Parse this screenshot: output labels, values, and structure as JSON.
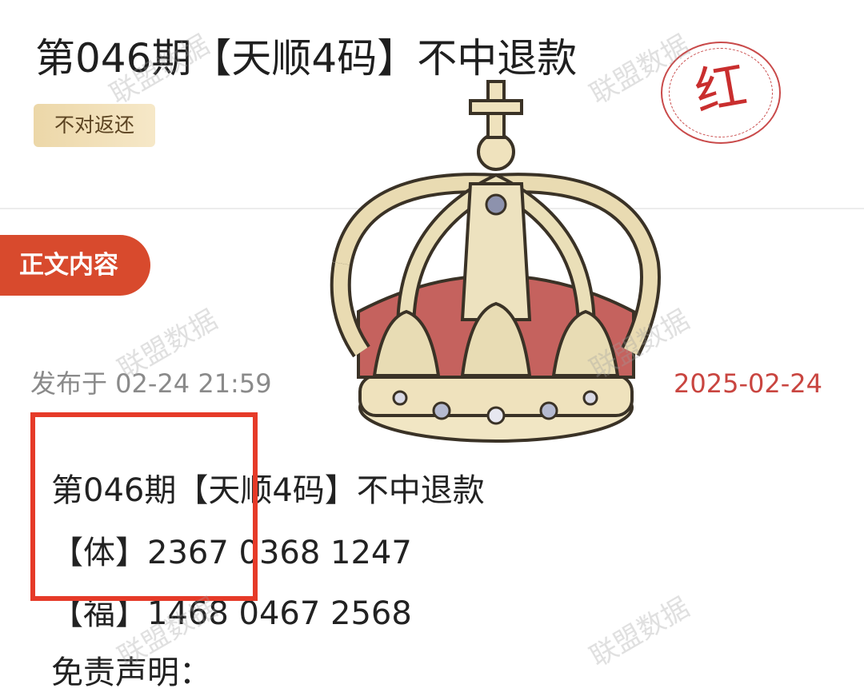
{
  "article": {
    "title": "第046期【天顺4码】不中退款",
    "tag": "不对返还",
    "stamp": "红"
  },
  "section": {
    "label": "正文内容"
  },
  "meta": {
    "published": "发布于 02-24 21:59",
    "date": "2025-02-24"
  },
  "content": {
    "lines": [
      "第046期【天顺4码】不中退款",
      "【体】2367 0368 1247",
      "【福】1468 0467 2568",
      "免责声明："
    ]
  },
  "watermark": "联盟数据",
  "colors": {
    "accent": "#d84a2d",
    "date": "#c94540",
    "highlight_box": "#e63a28",
    "tag_bg": "#ecd7a8"
  }
}
